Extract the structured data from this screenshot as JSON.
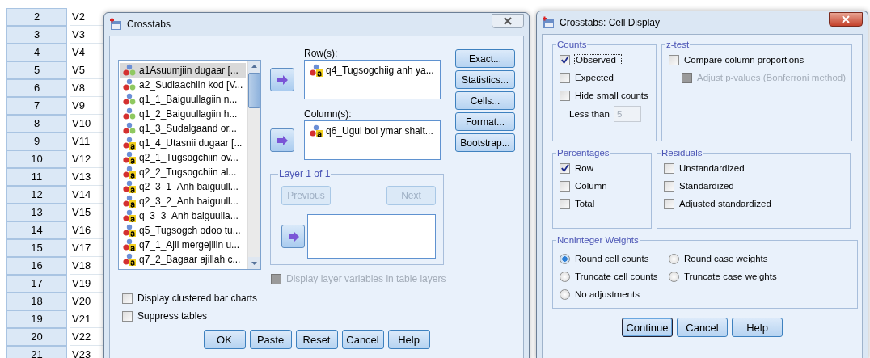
{
  "spreadsheet": {
    "rows": [
      {
        "number": "2",
        "variable": "V2"
      },
      {
        "number": "3",
        "variable": "V3"
      },
      {
        "number": "4",
        "variable": "V4"
      },
      {
        "number": "5",
        "variable": "V5"
      },
      {
        "number": "6",
        "variable": "V8"
      },
      {
        "number": "7",
        "variable": "V9"
      },
      {
        "number": "8",
        "variable": "V10"
      },
      {
        "number": "9",
        "variable": "V11"
      },
      {
        "number": "10",
        "variable": "V12"
      },
      {
        "number": "11",
        "variable": "V13"
      },
      {
        "number": "12",
        "variable": "V14"
      },
      {
        "number": "13",
        "variable": "V15"
      },
      {
        "number": "14",
        "variable": "V16"
      },
      {
        "number": "15",
        "variable": "V17"
      },
      {
        "number": "16",
        "variable": "V18"
      },
      {
        "number": "17",
        "variable": "V19"
      },
      {
        "number": "18",
        "variable": "V20"
      },
      {
        "number": "19",
        "variable": "V21"
      },
      {
        "number": "20",
        "variable": "V22"
      },
      {
        "number": "21",
        "variable": "V23"
      }
    ]
  },
  "crosstabs": {
    "title": "Crosstabs",
    "variables": [
      {
        "label": "a1Asuumjiin dugaar [...",
        "kind": "nominal",
        "selected": true
      },
      {
        "label": "a2_Sudlaachiin kod [V...",
        "kind": "nominal",
        "selected": false
      },
      {
        "label": "q1_1_Baiguullagiin n...",
        "kind": "nominal",
        "selected": false
      },
      {
        "label": "q1_2_Baiguullagiin h...",
        "kind": "nominal",
        "selected": false
      },
      {
        "label": "q1_3_Sudalgaand or...",
        "kind": "nominal",
        "selected": false
      },
      {
        "label": "q1_4_Utasnii dugaar [...",
        "kind": "string",
        "selected": false
      },
      {
        "label": "q2_1_Tugsogchiin ov...",
        "kind": "string",
        "selected": false
      },
      {
        "label": "q2_2_Tugsogchiin al...",
        "kind": "string",
        "selected": false
      },
      {
        "label": "q2_3_1_Anh baiguull...",
        "kind": "string",
        "selected": false
      },
      {
        "label": "q2_3_2_Anh baiguull...",
        "kind": "string",
        "selected": false
      },
      {
        "label": "q_3_3_Anh baiguulla...",
        "kind": "string",
        "selected": false
      },
      {
        "label": "q5_Tugsogch odoo tu...",
        "kind": "string",
        "selected": false
      },
      {
        "label": "q7_1_Ajil mergejliin u...",
        "kind": "string",
        "selected": false
      },
      {
        "label": "q7_2_Bagaar ajillah c...",
        "kind": "string",
        "selected": false
      }
    ],
    "rows_label": "Row(s):",
    "rows": [
      {
        "label": "q4_Tugsogchiig anh ya...",
        "kind": "string"
      }
    ],
    "columns_label": "Column(s):",
    "columns": [
      {
        "label": "q6_Ugui bol ymar shalt...",
        "kind": "string"
      }
    ],
    "layer": {
      "title": "Layer 1 of 1",
      "previous": {
        "label": "Previous",
        "disabled": true
      },
      "next": {
        "label": "Next",
        "disabled": true
      }
    },
    "display_layer": {
      "label": "Display layer variables in table layers",
      "checked": false,
      "disabled": true
    },
    "side_buttons": [
      "Exact...",
      "Statistics...",
      "Cells...",
      "Format...",
      "Bootstrap..."
    ],
    "options": [
      {
        "label": "Display clustered bar charts",
        "checked": false
      },
      {
        "label": "Suppress tables",
        "checked": false
      }
    ],
    "buttons": [
      {
        "label": "OK",
        "default": false
      },
      {
        "label": "Paste",
        "default": false
      },
      {
        "label": "Reset",
        "default": false
      },
      {
        "label": "Cancel",
        "default": false
      },
      {
        "label": "Help",
        "default": false
      }
    ]
  },
  "cell_display": {
    "title": "Crosstabs: Cell Display",
    "counts": {
      "title": "Counts",
      "items": [
        {
          "label": "Observed",
          "checked": true,
          "focused": true
        },
        {
          "label": "Expected",
          "checked": false,
          "focused": false
        },
        {
          "label": "Hide small counts",
          "checked": false,
          "focused": false
        }
      ],
      "less_than": {
        "label": "Less than",
        "value": "5",
        "disabled": true
      }
    },
    "z_test": {
      "title": "z-test",
      "compare": {
        "label": "Compare column proportions",
        "checked": false
      },
      "adjust": {
        "label": "Adjust p-values (Bonferroni method)",
        "checked": false,
        "disabled": true
      }
    },
    "percentages": {
      "title": "Percentages",
      "items": [
        {
          "label": "Row",
          "checked": true
        },
        {
          "label": "Column",
          "checked": false
        },
        {
          "label": "Total",
          "checked": false
        }
      ]
    },
    "residuals": {
      "title": "Residuals",
      "items": [
        {
          "label": "Unstandardized",
          "checked": false
        },
        {
          "label": "Standardized",
          "checked": false
        },
        {
          "label": "Adjusted standardized",
          "checked": false
        }
      ]
    },
    "weights": {
      "title": "Noninteger Weights",
      "items": [
        {
          "label": "Round cell counts",
          "selected": true
        },
        {
          "label": "Round case weights",
          "selected": false
        },
        {
          "label": "Truncate cell counts",
          "selected": false
        },
        {
          "label": "Truncate case weights",
          "selected": false
        },
        {
          "label": "No adjustments",
          "selected": false
        }
      ]
    },
    "buttons": [
      {
        "label": "Continue",
        "default": true
      },
      {
        "label": "Cancel",
        "default": false
      },
      {
        "label": "Help",
        "default": false
      }
    ]
  }
}
